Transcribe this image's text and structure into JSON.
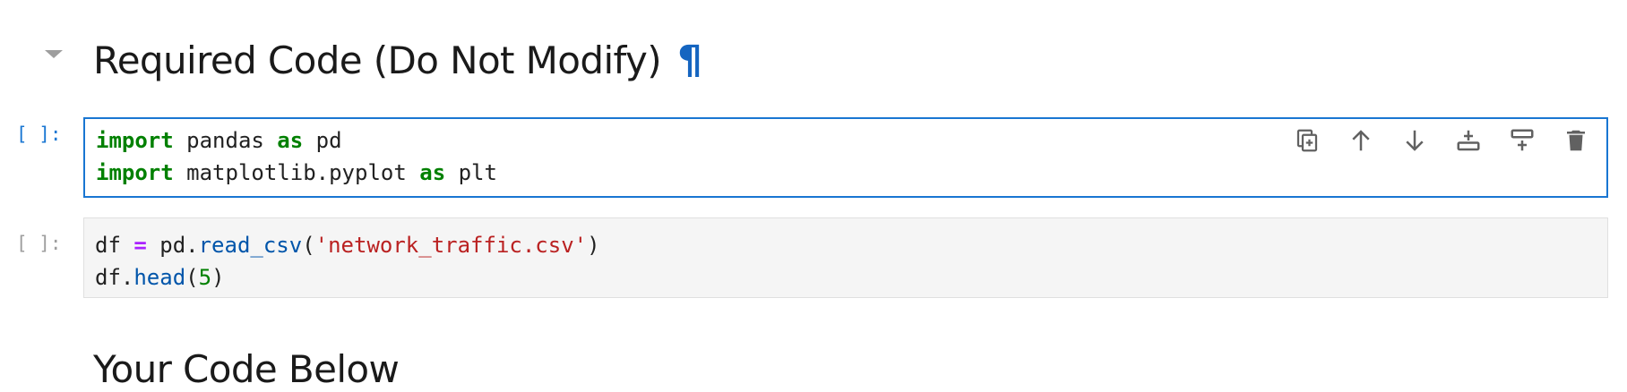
{
  "headings": {
    "required": "Required Code (Do Not Modify)",
    "anchor": "¶",
    "yours": "Your Code Below"
  },
  "cells": [
    {
      "prompt": "[ ]:",
      "active": true,
      "lines": [
        [
          [
            "kw",
            "import"
          ],
          [
            "plain",
            " pandas "
          ],
          [
            "kw",
            "as"
          ],
          [
            "plain",
            " pd"
          ]
        ],
        [
          [
            "kw",
            "import"
          ],
          [
            "plain",
            " matplotlib.pyplot "
          ],
          [
            "kw",
            "as"
          ],
          [
            "plain",
            " plt"
          ]
        ]
      ]
    },
    {
      "prompt": "[ ]:",
      "active": false,
      "lines": [
        [
          [
            "plain",
            "df "
          ],
          [
            "op",
            "="
          ],
          [
            "plain",
            " pd."
          ],
          [
            "fn",
            "read_csv"
          ],
          [
            "plain",
            "("
          ],
          [
            "str",
            "'network_traffic.csv'"
          ],
          [
            "plain",
            ")"
          ]
        ],
        [
          [
            "plain",
            "df."
          ],
          [
            "fn",
            "head"
          ],
          [
            "plain",
            "("
          ],
          [
            "num",
            "5"
          ],
          [
            "plain",
            ")"
          ]
        ]
      ]
    }
  ],
  "cell_toolbar": {
    "icons": [
      "duplicate-cell-icon",
      "move-up-icon",
      "move-down-icon",
      "insert-below-icon",
      "insert-above-icon",
      "delete-cell-icon"
    ]
  },
  "colors": {
    "active_border": "#1976d2",
    "anchor": "#1565c0",
    "keyword": "#008000",
    "operator": "#aa22ff",
    "function": "#0055aa",
    "string": "#ba2121"
  }
}
